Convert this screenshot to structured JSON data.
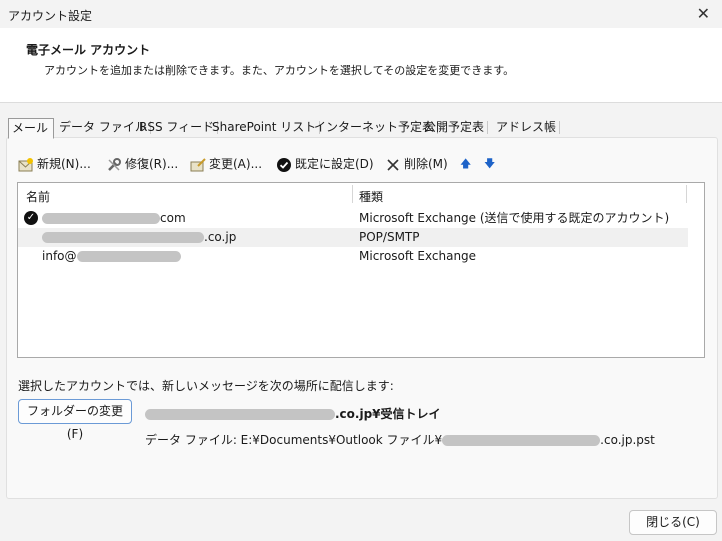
{
  "window": {
    "title": "アカウント設定",
    "close_glyph": "✕"
  },
  "header": {
    "title": "電子メール アカウント",
    "description": "アカウントを追加または削除できます。また、アカウントを選択してその設定を変更できます。"
  },
  "tabs": [
    {
      "label": "メール",
      "active": true
    },
    {
      "label": "データ ファイル"
    },
    {
      "label": "RSS フィード"
    },
    {
      "label": "SharePoint リスト"
    },
    {
      "label": "インターネット予定表"
    },
    {
      "label": "公開予定表"
    },
    {
      "label": "アドレス帳"
    }
  ],
  "toolbar": {
    "new_label": "新規(N)...",
    "repair_label": "修復(R)...",
    "change_label": "変更(A)...",
    "default_label": "既定に設定(D)",
    "delete_label": "削除(M)",
    "up_glyph": "🡅",
    "down_glyph": "🡇"
  },
  "accounts": {
    "columns": {
      "name": "名前",
      "type": "種類"
    },
    "rows": [
      {
        "name_suffix": "com",
        "type": "Microsoft Exchange (送信で使用する既定のアカウント)",
        "default": true
      },
      {
        "name_suffix": ".co.jp",
        "type": "POP/SMTP",
        "selected": true
      },
      {
        "name_prefix": "info@",
        "name_suffix": "",
        "type": "Microsoft Exchange"
      }
    ]
  },
  "delivery": {
    "label": "選択したアカウントでは、新しいメッセージを次の場所に配信します:",
    "folder_button": "フォルダーの変更(F)",
    "destination_suffix": ".co.jp¥受信トレイ",
    "datafile_prefix": "データ ファイル: E:¥Documents¥Outlook ファイル¥",
    "datafile_suffix": ".co.jp.pst"
  },
  "footer": {
    "close_label": "閉じる(C)"
  },
  "colors": {
    "accent": "#1e63c8",
    "delete": "#333333"
  }
}
